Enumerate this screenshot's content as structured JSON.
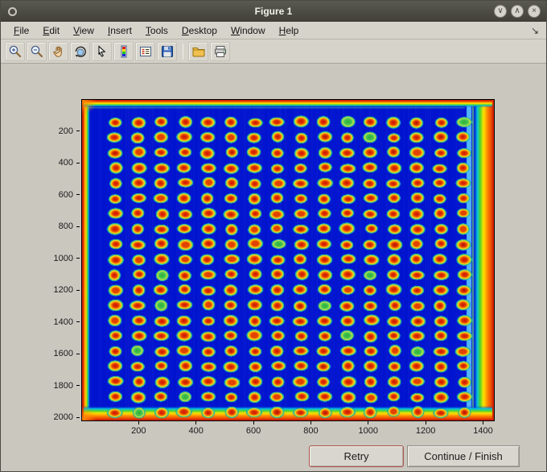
{
  "window": {
    "title": "Figure 1",
    "controls": [
      {
        "name": "minimize",
        "glyph": "∨"
      },
      {
        "name": "maximize",
        "glyph": "∧"
      },
      {
        "name": "close",
        "glyph": "×"
      }
    ]
  },
  "menubar": {
    "items": [
      {
        "label": "File",
        "accel": 0
      },
      {
        "label": "Edit",
        "accel": 0
      },
      {
        "label": "View",
        "accel": 0
      },
      {
        "label": "Insert",
        "accel": 0
      },
      {
        "label": "Tools",
        "accel": 0
      },
      {
        "label": "Desktop",
        "accel": 0
      },
      {
        "label": "Window",
        "accel": 0
      },
      {
        "label": "Help",
        "accel": 0
      }
    ],
    "dock_icon": "↘"
  },
  "toolbar": {
    "buttons": [
      {
        "name": "zoom-in"
      },
      {
        "name": "zoom-out"
      },
      {
        "name": "pan"
      },
      {
        "name": "rotate-3d"
      },
      {
        "name": "data-cursor"
      },
      {
        "name": "colorbar"
      },
      {
        "name": "insert-legend"
      },
      {
        "name": "save"
      },
      {
        "name": "separator"
      },
      {
        "name": "open"
      },
      {
        "name": "print"
      }
    ]
  },
  "figure": {
    "axes": {
      "x_ticks": [
        200,
        400,
        600,
        800,
        1000,
        1200,
        1400
      ],
      "y_ticks": [
        200,
        400,
        600,
        800,
        1000,
        1200,
        1400,
        1600,
        1800,
        2000
      ],
      "x_range": [
        0,
        1435
      ],
      "y_range": [
        0,
        2015
      ]
    },
    "image": {
      "type": "microarray-spot-grid",
      "colormap": "jet",
      "rows": 20,
      "cols": 16,
      "first_spot_x": 115,
      "first_spot_y": 140,
      "spot_spacing_x": 81,
      "spot_spacing_y": 96,
      "background": "#0013cf",
      "edge_color": "#d42400",
      "spot_core": "#cf0f00",
      "spot_ring": "#ffe400",
      "spot_halo": "#00c8e8"
    }
  },
  "buttons": {
    "retry": "Retry",
    "continue_finish": "Continue / Finish"
  }
}
